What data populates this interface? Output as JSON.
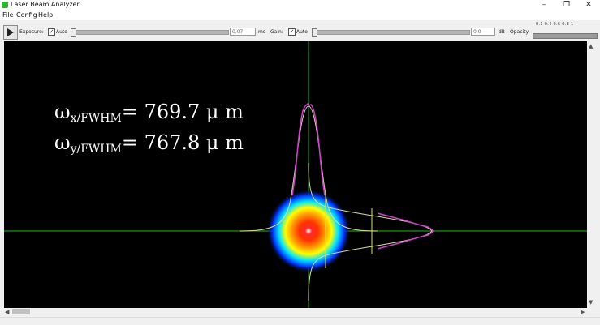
{
  "window": {
    "title": "Laser Beam Analyzer",
    "minimize_icon": "minimize-icon",
    "maximize_icon": "restore-icon",
    "close_icon": "close-icon"
  },
  "menu": {
    "items": [
      "File",
      "Config",
      "Help"
    ]
  },
  "toolbar": {
    "play_icon": "play-icon",
    "exposure_label": "Exposure:",
    "exposure_auto_label": "Auto",
    "exposure_auto_checked": true,
    "exposure_value": "0.07",
    "exposure_unit": "ms",
    "gain_label": "Gain:",
    "gain_auto_label": "Auto",
    "gain_auto_checked": true,
    "gain_value": "0.0",
    "gain_unit": "dB",
    "opacity_label": "Opacity",
    "opacity_scale": "0.1 0.4 0.6 0.8 1"
  },
  "viewport": {
    "readout_x_symbol": "ω",
    "readout_x_sub": "x/FWHM",
    "readout_x_value": "= 769.7 μ m",
    "readout_y_symbol": "ω",
    "readout_y_sub": "y/FWHM",
    "readout_y_value": "= 767.8 μ m",
    "crosshair_color": "#1f8f1f",
    "profile_color": "#d040d0",
    "fit_color": "#d8d8a0",
    "marker_color": "#e6e62e",
    "background_color": "#000000"
  },
  "scrollbars": {
    "up_arrow_icon": "up-arrow-icon",
    "down_arrow_icon": "down-arrow-icon",
    "left_arrow_icon": "left-arrow-icon",
    "right_arrow_icon": "right-arrow-icon"
  }
}
